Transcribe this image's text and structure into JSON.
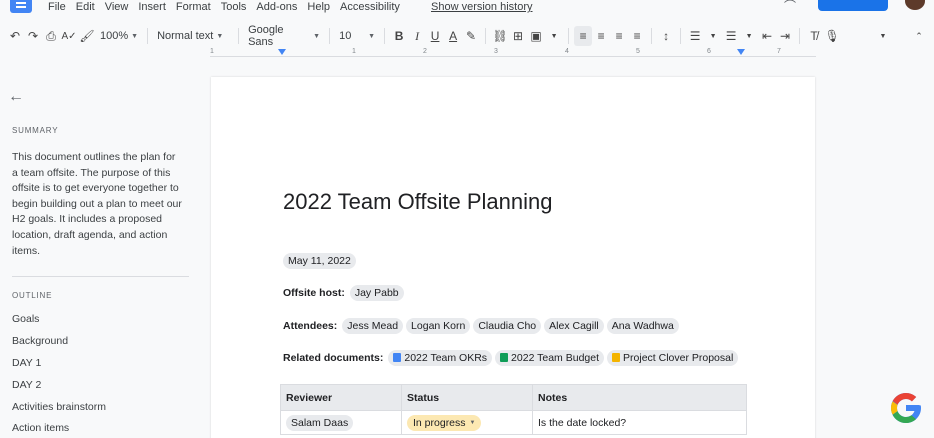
{
  "menubar": {
    "items": [
      "File",
      "Edit",
      "View",
      "Insert",
      "Format",
      "Tools",
      "Add-ons",
      "Help",
      "Accessibility"
    ],
    "version_link": "Show version history"
  },
  "toolbar": {
    "zoom": "100%",
    "style": "Normal text",
    "font": "Google Sans",
    "size": "10"
  },
  "ruler": {
    "ticks": [
      "1",
      "1",
      "2",
      "3",
      "4",
      "5",
      "6",
      "7"
    ]
  },
  "sidebar": {
    "summary_label": "SUMMARY",
    "summary_text": "This document outlines the plan for a team offsite. The purpose of this offsite is to get everyone together to begin building out a plan to meet our H2 goals. It includes a proposed location, draft agenda, and action items.",
    "outline_label": "OUTLINE",
    "outline": [
      "Goals",
      "Background",
      "DAY 1",
      "DAY 2",
      "Activities brainstorm",
      "Action items"
    ]
  },
  "document": {
    "title": "2022 Team Offsite Planning",
    "date": "May 11, 2022",
    "host_label": "Offsite host:",
    "host": "Jay Pabb",
    "attendees_label": "Attendees:",
    "attendees": [
      "Jess Mead",
      "Logan Korn",
      "Claudia Cho",
      "Alex Cagill",
      "Ana Wadhwa"
    ],
    "related_label": "Related documents:",
    "related": [
      {
        "name": "2022 Team OKRs",
        "color": "#4285f4"
      },
      {
        "name": "2022 Team Budget",
        "color": "#0f9d58"
      },
      {
        "name": "Project Clover Proposal",
        "color": "#f4b400"
      }
    ],
    "table": {
      "headers": [
        "Reviewer",
        "Status",
        "Notes"
      ],
      "rows": [
        {
          "reviewer": "Salam Daas",
          "status": "In progress",
          "notes": "Is the date locked?"
        }
      ]
    }
  },
  "colors": {
    "accent": "#1a73e8",
    "status_in_progress": "#fce8b2",
    "chip_bg": "#e8eaed"
  }
}
